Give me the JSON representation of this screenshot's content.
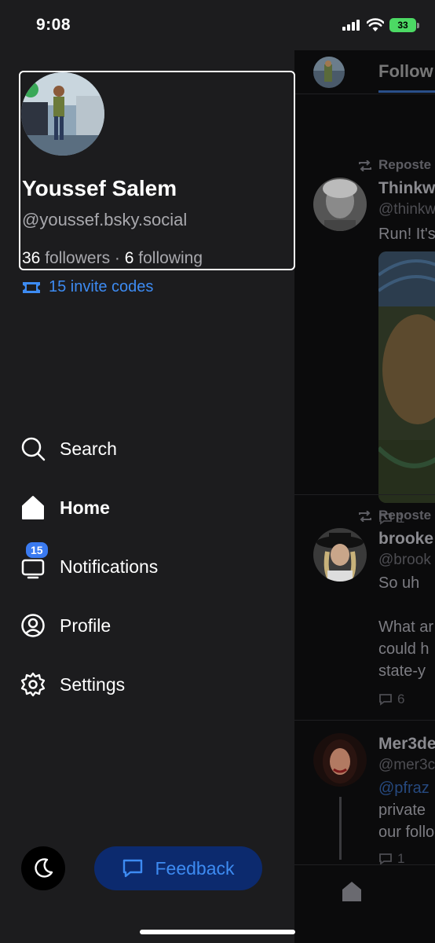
{
  "status_bar": {
    "time": "9:08",
    "battery": "33"
  },
  "drawer": {
    "name": "Youssef Salem",
    "handle": "@youssef.bsky.social",
    "followers_count": "36",
    "followers_label": "followers",
    "separator": "·",
    "following_count": "6",
    "following_label": "following",
    "invite_codes": "15 invite codes",
    "nav": {
      "search": "Search",
      "home": "Home",
      "notifications": "Notifications",
      "notifications_badge": "15",
      "profile": "Profile",
      "settings": "Settings"
    },
    "feedback_label": "Feedback"
  },
  "feed": {
    "tab_label": "Follow",
    "posts": [
      {
        "repost_label": "Reposte",
        "name": "Thinkw",
        "handle": "@thinkw",
        "text": "Run! It's",
        "comments": "1"
      },
      {
        "repost_label": "Reposte",
        "name": "brooke",
        "handle": "@brook",
        "text_1": "So uh",
        "text_2": "What ar\ncould h\nstate-y",
        "comments": "6"
      },
      {
        "name": "Mer3de",
        "handle": "@mer3c",
        "mention": "@pfraz",
        "text": "private\nour follo",
        "comments": "1"
      }
    ]
  },
  "colors": {
    "accent": "#3d8bf2",
    "feedback_bg": "#0c2a6e",
    "drawer_bg": "#1c1c1e"
  }
}
